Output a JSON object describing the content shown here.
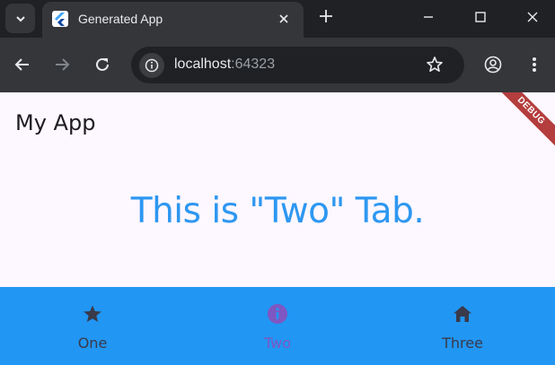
{
  "browser": {
    "tab_title": "Generated App",
    "url_host": "localhost",
    "url_port": ":64323"
  },
  "app": {
    "title": "My App",
    "content_text": "This is \"Two\" Tab.",
    "debug_banner": "DEBUG",
    "bottom_nav": {
      "items": [
        {
          "label": "One",
          "icon": "star-icon",
          "selected": false
        },
        {
          "label": "Two",
          "icon": "info-icon",
          "selected": true
        },
        {
          "label": "Three",
          "icon": "home-icon",
          "selected": false
        }
      ]
    }
  },
  "colors": {
    "app_background": "#fdf7ff",
    "content_text": "#2d97f1",
    "bottom_nav_background": "#2196f3",
    "nav_selected": "#7e57c2",
    "nav_unselected": "#3a3a4a",
    "debug_banner": "#b43d3d"
  }
}
